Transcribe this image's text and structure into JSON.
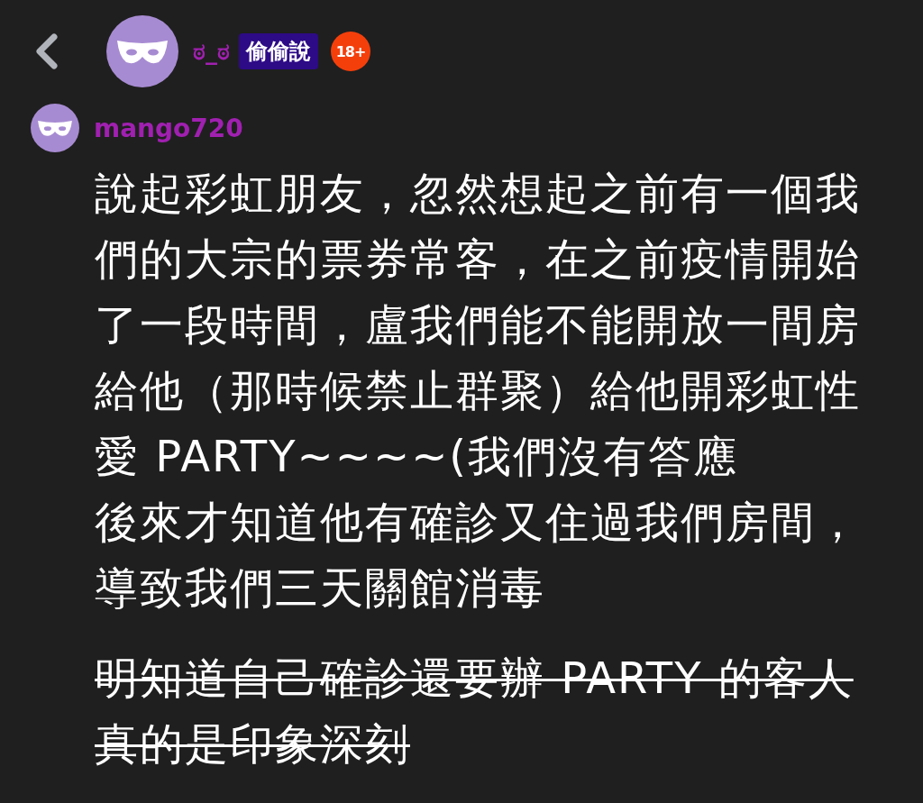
{
  "header": {
    "board_name": "ಠ_ಠ",
    "board_tag": "偷偷說",
    "age_badge": "18+"
  },
  "comment": {
    "author": "mango720",
    "paragraphs": [
      {
        "text": "說起彩虹朋友，忽然想起之前有一個我們的大宗的票券常客，在之前疫情開始了一段時間，盧我們能不能開放一間房給他（那時候禁止群聚）給他開彩虹性愛 PARTY~~~~(我們沒有答應",
        "strikethrough": false
      },
      {
        "text": "後來才知道他有確診又住過我們房間，導致我們三天關館消毒",
        "strikethrough": false
      }
    ],
    "closing_note": {
      "text": "明知道自己確診還要辦 PARTY 的客人真的是印象深刻",
      "strikethrough": true
    }
  }
}
